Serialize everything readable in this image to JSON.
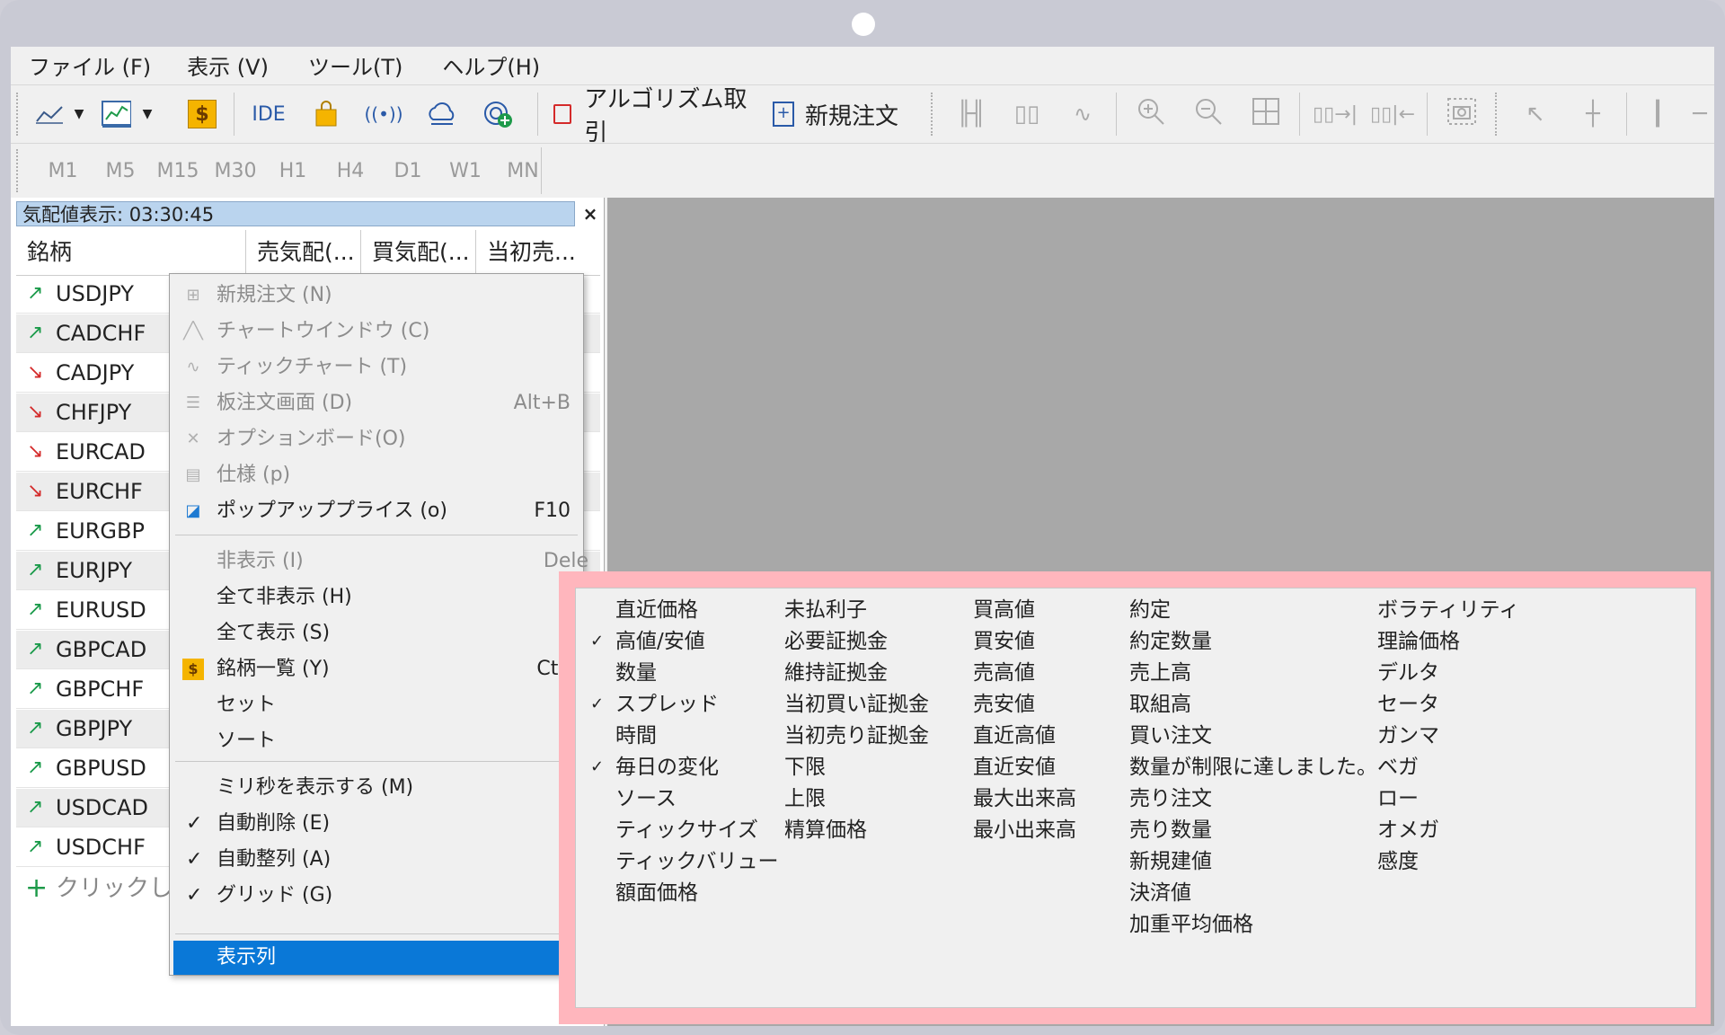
{
  "menubar": [
    "ファイル (F)",
    "表示 (V)",
    "ツール(T)",
    "ヘルプ(H)"
  ],
  "toolbar": {
    "ide_label": "IDE",
    "algo_label": "アルゴリズム取引",
    "new_order_label": "新規注文"
  },
  "timeframes": [
    "M1",
    "M5",
    "M15",
    "M30",
    "H1",
    "H4",
    "D1",
    "W1",
    "MN"
  ],
  "market_watch": {
    "title": "気配値表示: 03:30:45",
    "close": "×",
    "headers": [
      "銘柄",
      "売気配(...",
      "買気配(...",
      "当初売..."
    ],
    "rows": [
      {
        "symbol": "USDJPY",
        "dir": "up"
      },
      {
        "symbol": "CADCHF",
        "dir": "up"
      },
      {
        "symbol": "CADJPY",
        "dir": "down"
      },
      {
        "symbol": "CHFJPY",
        "dir": "down"
      },
      {
        "symbol": "EURCAD",
        "dir": "down"
      },
      {
        "symbol": "EURCHF",
        "dir": "down"
      },
      {
        "symbol": "EURGBP",
        "dir": "up"
      },
      {
        "symbol": "EURJPY",
        "dir": "up"
      },
      {
        "symbol": "EURUSD",
        "dir": "up"
      },
      {
        "symbol": "GBPCAD",
        "dir": "up"
      },
      {
        "symbol": "GBPCHF",
        "dir": "up"
      },
      {
        "symbol": "GBPJPY",
        "dir": "up"
      },
      {
        "symbol": "GBPUSD",
        "dir": "up"
      },
      {
        "symbol": "USDCAD",
        "dir": "up"
      },
      {
        "symbol": "USDCHF",
        "dir": "up"
      }
    ],
    "add_symbol": "+ クリックして"
  },
  "context_menu": {
    "group1": [
      {
        "label": "新規注文 (N)",
        "shortcut": "",
        "disabled": true
      },
      {
        "label": "チャートウインドウ (C)",
        "shortcut": "",
        "disabled": true
      },
      {
        "label": "ティックチャート (T)",
        "shortcut": "",
        "disabled": true
      },
      {
        "label": "板注文画面 (D)",
        "shortcut": "Alt+B",
        "disabled": true
      },
      {
        "label": "オプションボード(O)",
        "shortcut": "",
        "disabled": true
      },
      {
        "label": "仕様 (p)",
        "shortcut": "",
        "disabled": true
      },
      {
        "label": "ポップアッププライス (o)",
        "shortcut": "F10",
        "disabled": false
      }
    ],
    "group2": [
      {
        "label": "非表示 (I)",
        "shortcut": "Dele",
        "disabled": true
      },
      {
        "label": "全て非表示 (H)",
        "shortcut": "",
        "disabled": false
      },
      {
        "label": "全て表示 (S)",
        "shortcut": "",
        "disabled": false
      },
      {
        "label": "銘柄一覧 (Y)",
        "shortcut": "Ctrl+",
        "disabled": false
      },
      {
        "label": "セット",
        "shortcut": "",
        "disabled": false
      },
      {
        "label": "ソート",
        "shortcut": "",
        "disabled": false
      }
    ],
    "group3": [
      {
        "label": "ミリ秒を表示する (M)",
        "checked": false
      },
      {
        "label": "自動削除 (E)",
        "checked": true
      },
      {
        "label": "自動整列 (A)",
        "checked": true
      },
      {
        "label": "グリッド (G)",
        "checked": true
      }
    ],
    "selected": "表示列"
  },
  "columns_submenu": {
    "col1": [
      {
        "label": "直近価格",
        "checked": false
      },
      {
        "label": "高値/安値",
        "checked": true
      },
      {
        "label": "数量",
        "checked": false
      },
      {
        "label": "スプレッド",
        "checked": true
      },
      {
        "label": "時間",
        "checked": false
      },
      {
        "label": "毎日の変化",
        "checked": true
      },
      {
        "label": "ソース",
        "checked": false
      },
      {
        "label": "ティックサイズ",
        "checked": false
      },
      {
        "label": "ティックバリュー",
        "checked": false
      },
      {
        "label": "額面価格",
        "checked": false
      }
    ],
    "col2": [
      "未払利子",
      "必要証拠金",
      "維持証拠金",
      "当初買い証拠金",
      "当初売り証拠金",
      "下限",
      "上限",
      "精算価格"
    ],
    "col3": [
      "買高値",
      "買安値",
      "売高値",
      "売安値",
      "直近高値",
      "直近安値",
      "最大出来高",
      "最小出来高"
    ],
    "col4": [
      "約定",
      "約定数量",
      "売上高",
      "取組高",
      "買い注文",
      "数量が制限に達しました。",
      "売り注文",
      "売り数量",
      "新規建値",
      "決済値",
      "加重平均価格"
    ],
    "col5": [
      "ボラティリティ",
      "理論価格",
      "デルタ",
      "セータ",
      "ガンマ",
      "ベガ",
      "ロー",
      "オメガ",
      "感度"
    ]
  },
  "colors": {
    "up": "#1a9a4a",
    "down": "#d42a2a",
    "highlight": "#0a78d7",
    "callout": "#ffb6bd"
  }
}
